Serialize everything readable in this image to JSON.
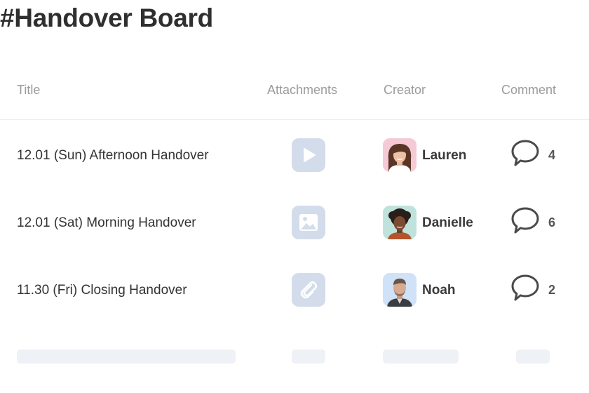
{
  "page": {
    "title": "#Handover Board"
  },
  "columns": {
    "title": "Title",
    "attachments": "Attachments",
    "creator": "Creator",
    "comment": "Comment"
  },
  "rows": [
    {
      "title": "12.01 (Sun) Afternoon Handover",
      "attachment_icon": "play-icon",
      "creator": "Lauren",
      "avatar_bg": "#f6c9d6",
      "comments": "4"
    },
    {
      "title": "12.01 (Sat) Morning Handover",
      "attachment_icon": "image-icon",
      "creator": "Danielle",
      "avatar_bg": "#bfe3dc",
      "comments": "6"
    },
    {
      "title": "11.30 (Fri) Closing Handover",
      "attachment_icon": "paperclip-icon",
      "creator": "Noah",
      "avatar_bg": "#cfe2f7",
      "comments": "2"
    }
  ],
  "colors": {
    "attachment_tile": "#d3dceb",
    "skeleton": "#eef1f5",
    "header_text": "#9b9b9b",
    "divider": "#ececec"
  }
}
